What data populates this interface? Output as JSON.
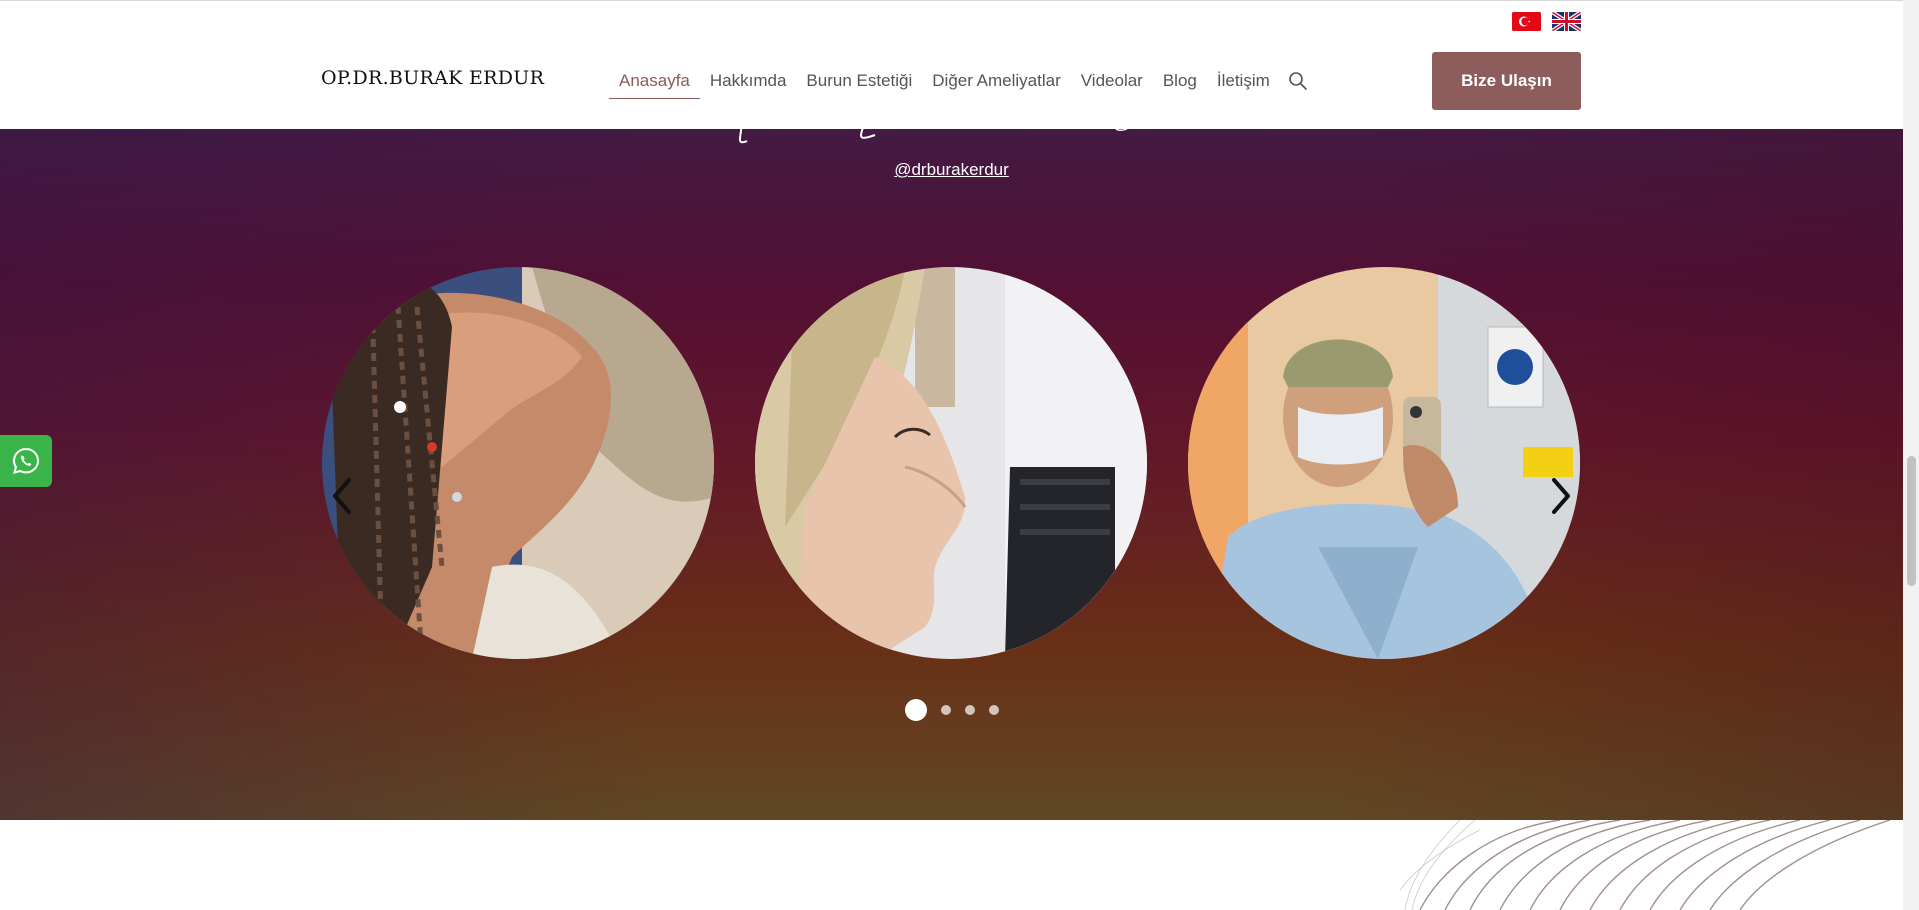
{
  "header": {
    "logo": "OP.DR.BURAK ERDUR",
    "nav": [
      {
        "label": "Anasayfa",
        "active": true
      },
      {
        "label": "Hakkımda",
        "active": false
      },
      {
        "label": "Burun Estetiği",
        "active": false
      },
      {
        "label": "Diğer Ameliyatlar",
        "active": false
      },
      {
        "label": "Videolar",
        "active": false
      },
      {
        "label": "Blog",
        "active": false
      },
      {
        "label": "İletişim",
        "active": false
      }
    ],
    "search_icon": "search-icon",
    "cta_label": "Bize Ulaşın",
    "languages": [
      "tr-flag-icon",
      "en-flag-icon"
    ]
  },
  "hero": {
    "handle": "@drburakerdur",
    "slides": [
      {
        "name": "profile-photo-woman-braids"
      },
      {
        "name": "profile-photo-woman-nose"
      },
      {
        "name": "surgeon-selfie-photo"
      }
    ],
    "dots": [
      true,
      false,
      false,
      false
    ]
  },
  "colors": {
    "accent": "#8c5d5b",
    "whatsapp": "#3bb54a"
  }
}
